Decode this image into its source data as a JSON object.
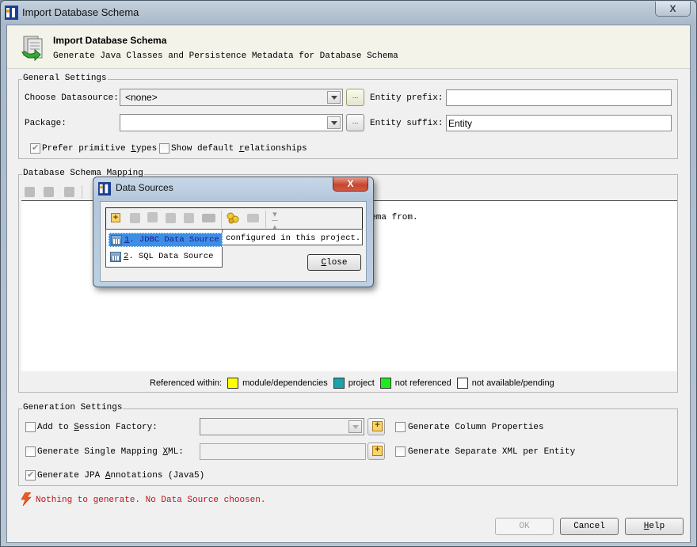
{
  "window": {
    "title": "Import Database Schema",
    "close_label": "X"
  },
  "header": {
    "title": "Import Database Schema",
    "subtitle": "Generate Java Classes and Persistence Metadata for Database Schema"
  },
  "general_settings": {
    "legend": "General Settings",
    "datasource_label": "Choose Datasource:",
    "datasource_value": "<none>",
    "package_label": "Package:",
    "package_value": "",
    "browse_label": "...",
    "entity_prefix_label": "Entity prefix:",
    "entity_prefix_value": "",
    "entity_suffix_label": "Entity suffix:",
    "entity_suffix_value": "Entity",
    "prefer_primitive": {
      "label_pre": "Prefer primitive ",
      "label_u": "t",
      "label_post": "ypes",
      "checked": true
    },
    "show_default_rel": {
      "label_pre": "Show default ",
      "label_u": "r",
      "label_post": "elationships",
      "checked": false
    }
  },
  "schema_mapping": {
    "legend": "Database Schema Mapping",
    "message_tail": "chema from.",
    "legend_bar": {
      "prefix": "Referenced within:",
      "items": [
        {
          "label": "module/dependencies",
          "color": "#ffff00"
        },
        {
          "label": "project",
          "color": "#1aa3a8"
        },
        {
          "label": "not referenced",
          "color": "#1eeb1e"
        },
        {
          "label": "not available/pending",
          "color": "#ffffff"
        }
      ]
    }
  },
  "generation_settings": {
    "legend": "Generation Settings",
    "add_session_factory": {
      "label_pre": "Add to ",
      "label_u": "S",
      "label_post": "ession Factory:",
      "checked": false
    },
    "single_mapping_xml": {
      "label_pre": "Generate Single Mapping ",
      "label_u": "X",
      "label_post": "ML:",
      "checked": false
    },
    "jpa_annotations": {
      "label_pre": "Generate JPA ",
      "label_u": "A",
      "label_post": "nnotations (Java5)",
      "checked": true
    },
    "column_properties": {
      "label": "Generate Column Properties",
      "checked": false
    },
    "separate_xml": {
      "label": "Generate Separate XML per Entity",
      "checked": false
    }
  },
  "status": {
    "error_message": "Nothing to generate. No Data Source choosen.",
    "error_color": "#c0101a"
  },
  "buttons": {
    "ok": "OK",
    "cancel": "Cancel",
    "help_u": "H",
    "help_rest": "elp"
  },
  "popup": {
    "title": "Data Sources",
    "close_label": "X",
    "items": [
      {
        "num": "1",
        "label": ". JDBC Data Source",
        "selected": true
      },
      {
        "num": "2",
        "label": ". SQL Data Source",
        "selected": false
      }
    ],
    "info_text": "configured in this project.",
    "close_button_u": "C",
    "close_button_rest": "lose",
    "toolbar_icons": [
      "add-icon",
      "remove-icon",
      "copy-icon",
      "properties-icon",
      "refresh-icon",
      "sql-icon",
      "merge-icon",
      "sql-console-icon",
      "collapse-icon"
    ]
  }
}
